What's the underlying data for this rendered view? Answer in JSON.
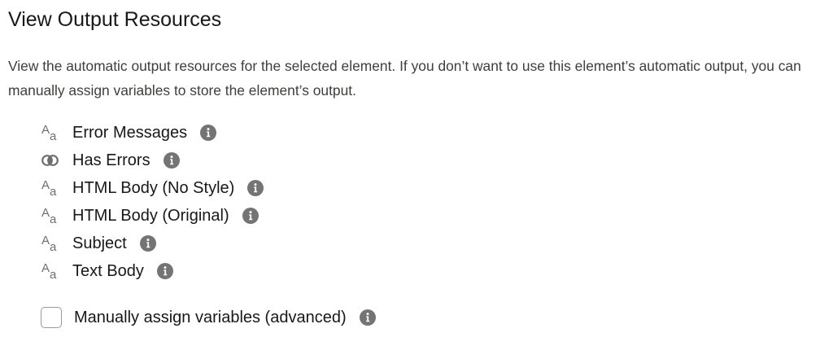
{
  "section": {
    "title": "View Output Resources",
    "description": "View the automatic output resources for the selected element. If you don’t want to use this element’s automatic output, you can manually assign variables to store the element’s output."
  },
  "resources": [
    {
      "label": "Error Messages",
      "type_icon": "text-type-icon"
    },
    {
      "label": "Has Errors",
      "type_icon": "boolean-type-icon"
    },
    {
      "label": "HTML Body (No Style)",
      "type_icon": "text-type-icon"
    },
    {
      "label": "HTML Body (Original)",
      "type_icon": "text-type-icon"
    },
    {
      "label": "Subject",
      "type_icon": "text-type-icon"
    },
    {
      "label": "Text Body",
      "type_icon": "text-type-icon"
    }
  ],
  "manual_assign": {
    "label": "Manually assign variables (advanced)",
    "checked": false
  },
  "icons": {
    "text_type_glyph_big": "A",
    "text_type_glyph_small": "a",
    "info": "info-icon"
  },
  "colors": {
    "info_icon_fill": "#747474",
    "type_icon": "#706e6b",
    "text": "#181818"
  }
}
